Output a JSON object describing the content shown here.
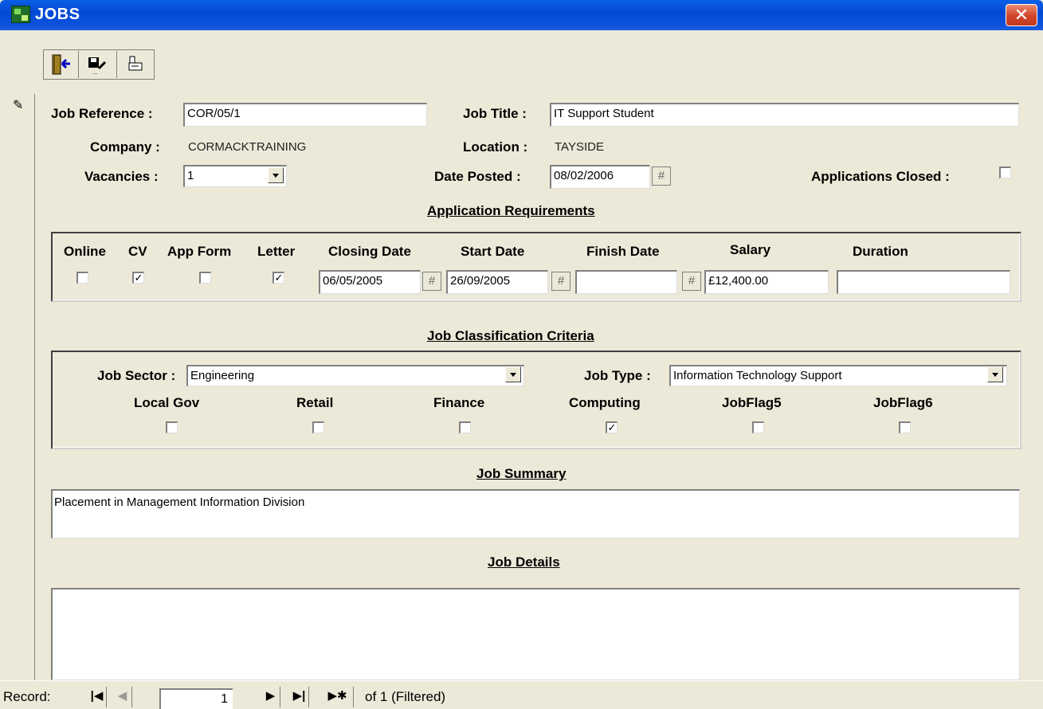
{
  "window": {
    "title": "JOBS",
    "close_glyph": "✕"
  },
  "toolbar": {
    "buttons": [
      {
        "icon": "exit-door-icon",
        "glyph": "⍈"
      },
      {
        "icon": "save-edit-icon",
        "glyph": "🖫"
      },
      {
        "icon": "print-icon",
        "glyph": "⎙"
      }
    ]
  },
  "form": {
    "job_reference_label": "Job Reference :",
    "job_reference": "COR/05/1",
    "job_title_label": "Job Title :",
    "job_title": "IT Support Student",
    "company_label": "Company :",
    "company": "CORMACKTRAINING",
    "location_label": "Location :",
    "location": "TAYSIDE",
    "vacancies_label": "Vacancies :",
    "vacancies": "1",
    "date_posted_label": "Date Posted :",
    "date_posted": "08/02/2006",
    "applications_closed_label": "Applications Closed :",
    "applications_closed": false
  },
  "requirements": {
    "section_title": "Application Requirements",
    "headers": {
      "online": "Online",
      "cv": "CV",
      "app_form": "App Form",
      "letter": "Letter",
      "closing_date": "Closing Date",
      "start_date": "Start Date",
      "finish_date": "Finish Date",
      "salary": "Salary",
      "duration": "Duration"
    },
    "online": false,
    "cv": true,
    "app_form": false,
    "letter": true,
    "closing_date": "06/05/2005",
    "start_date": "26/09/2005",
    "finish_date": "",
    "salary": "£12,400.00",
    "duration": ""
  },
  "classification": {
    "section_title": "Job Classification Criteria",
    "job_sector_label": "Job Sector :",
    "job_sector": "Engineering",
    "job_type_label": "Job Type :",
    "job_type": "Information Technology Support",
    "flags": [
      {
        "label": "Local Gov",
        "checked": false
      },
      {
        "label": "Retail",
        "checked": false
      },
      {
        "label": "Finance",
        "checked": false
      },
      {
        "label": "Computing",
        "checked": true
      },
      {
        "label": "JobFlag5",
        "checked": false
      },
      {
        "label": "JobFlag6",
        "checked": false
      }
    ]
  },
  "summary": {
    "section_title": "Job Summary",
    "text": "Placement in Management Information Division"
  },
  "details": {
    "section_title": "Job Details",
    "text": ""
  },
  "navigation": {
    "record_label": "Record:",
    "current": "1",
    "of_text": "of  1 (Filtered)"
  },
  "colors": {
    "titlebar": "#0448d4",
    "form_bg": "#ece9d8",
    "close": "#d2452a"
  }
}
